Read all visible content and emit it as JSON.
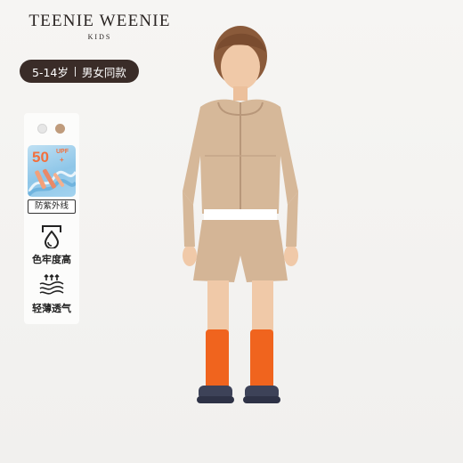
{
  "brand": {
    "title": "TEENIE WEENIE",
    "subtitle": "KIDS"
  },
  "pill": {
    "age": "5-14岁",
    "gender": "男女同款"
  },
  "swatches": [
    "#e6e6e6",
    "#bf9b7c"
  ],
  "features": {
    "upf": {
      "value": "50",
      "unit": "UPF",
      "plus": "+",
      "caption": "防紫外线"
    },
    "colorfast": {
      "icon": "water-drop-icon",
      "label": "色牢度高"
    },
    "breathable": {
      "icon": "airflow-waves-icon",
      "label": "轻薄透气"
    }
  },
  "colors": {
    "pill_bg": "#3a2c28",
    "accent_orange": "#f2703d",
    "socks": "#f0641e",
    "outfit": "#d6b899"
  }
}
